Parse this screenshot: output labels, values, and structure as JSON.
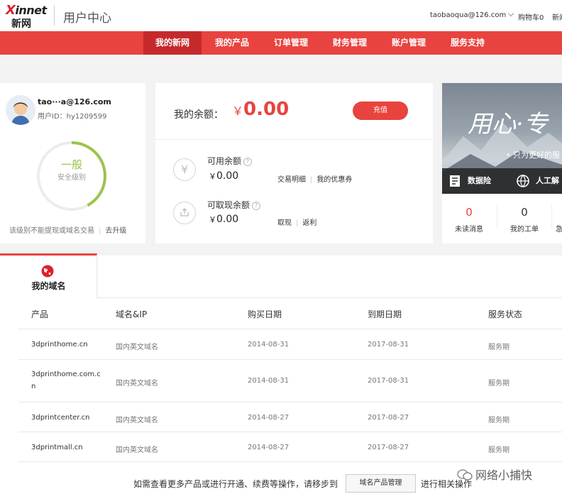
{
  "brand": {
    "logo_en": "innet",
    "logo_x": "X",
    "logo_cn": "新网",
    "section_title": "用户中心"
  },
  "top": {
    "account": "taobaoqua@126.com",
    "cart": "购物车0",
    "more": "新闻"
  },
  "nav": [
    {
      "label": "我的新网",
      "active": true
    },
    {
      "label": "我的产品"
    },
    {
      "label": "订单管理"
    },
    {
      "label": "财务管理"
    },
    {
      "label": "账户管理"
    },
    {
      "label": "服务支持"
    }
  ],
  "user": {
    "email": "tao···a@126.com",
    "user_id": "用户ID：hy1209599",
    "security_level": "一般",
    "security_label": "安全级别",
    "security_fraction": 0.42,
    "note": "该级别不能提现或域名交易",
    "upgrade": "去升级"
  },
  "balance": {
    "label": "我的余额：",
    "currency": "￥",
    "amount": "0.00",
    "recharge": "充值",
    "available_label": "可用余额",
    "available_value": "0.00",
    "available_links": [
      "交易明细",
      "我的优惠券"
    ],
    "withdrawable_label": "可取现余额",
    "withdrawable_value": "0.00",
    "withdrawable_links": [
      "取现",
      "返利"
    ]
  },
  "banner": {
    "headline": "用心·专",
    "tagline": "• 只为更好的服",
    "items": [
      "数据险",
      "人工解"
    ]
  },
  "stats": [
    {
      "value": "0",
      "label": "未读消息",
      "color": "#e8433f"
    },
    {
      "value": "0",
      "label": "我的工单",
      "color": "#333333"
    },
    {
      "label": "急"
    }
  ],
  "domains": {
    "tab": "我的域名",
    "headers": [
      "产品",
      "域名&IP",
      "购买日期",
      "到期日期",
      "服务状态"
    ],
    "rows": [
      {
        "product": "3dprinthome.cn",
        "type": "国内英文域名",
        "bought": "2014-08-31",
        "expires": "2017-08-31",
        "status": "服务期"
      },
      {
        "product": "3dprinthome.com.cn",
        "type": "国内英文域名",
        "bought": "2014-08-31",
        "expires": "2017-08-31",
        "status": "服务期"
      },
      {
        "product": "3dprintcenter.cn",
        "type": "国内英文域名",
        "bought": "2014-08-27",
        "expires": "2017-08-27",
        "status": "服务期"
      },
      {
        "product": "3dprintmall.cn",
        "type": "国内英文域名",
        "bought": "2014-08-27",
        "expires": "2017-08-27",
        "status": "服务期"
      }
    ]
  },
  "footer": {
    "note": "如需查看更多产品或进行开通、续费等操作，请移步到",
    "button": "域名产品管理",
    "note2": "进行相关操作"
  },
  "watermark": "网络小捕快",
  "colors": {
    "accent": "#e8433f",
    "nav_active": "#c6292c",
    "gauge": "#9bc44a"
  }
}
